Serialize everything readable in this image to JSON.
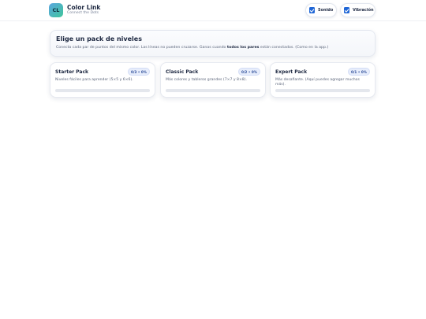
{
  "app": {
    "logo_text": "CL",
    "title": "Color Link",
    "subtitle": "Connect the Dots"
  },
  "settings": {
    "sound": {
      "label": "Sonido",
      "checked": true
    },
    "vibration": {
      "label": "Vibración",
      "checked": true
    }
  },
  "intro": {
    "title": "Elige un pack de niveles",
    "desc_before": "Conecta cada par de puntos del mismo color. Las líneas no pueden cruzarse. Ganas cuando ",
    "desc_bold": "todos los pares",
    "desc_after": " están conectados. (Como en la app.)"
  },
  "packs": [
    {
      "title": "Starter Pack",
      "badge": "0/3 • 0%",
      "desc": "Niveles fáciles para aprender (5×5 y 6×6).",
      "progress": 0
    },
    {
      "title": "Classic Pack",
      "badge": "0/2 • 0%",
      "desc": "Más colores y tableros grandes (7×7 y 8×8).",
      "progress": 0
    },
    {
      "title": "Expert Pack",
      "badge": "0/1 • 0%",
      "desc": "Más desafiante. (Aquí puedes agregar muchos más).",
      "progress": 0
    }
  ],
  "colors": {
    "accent": "#1f66d6"
  }
}
